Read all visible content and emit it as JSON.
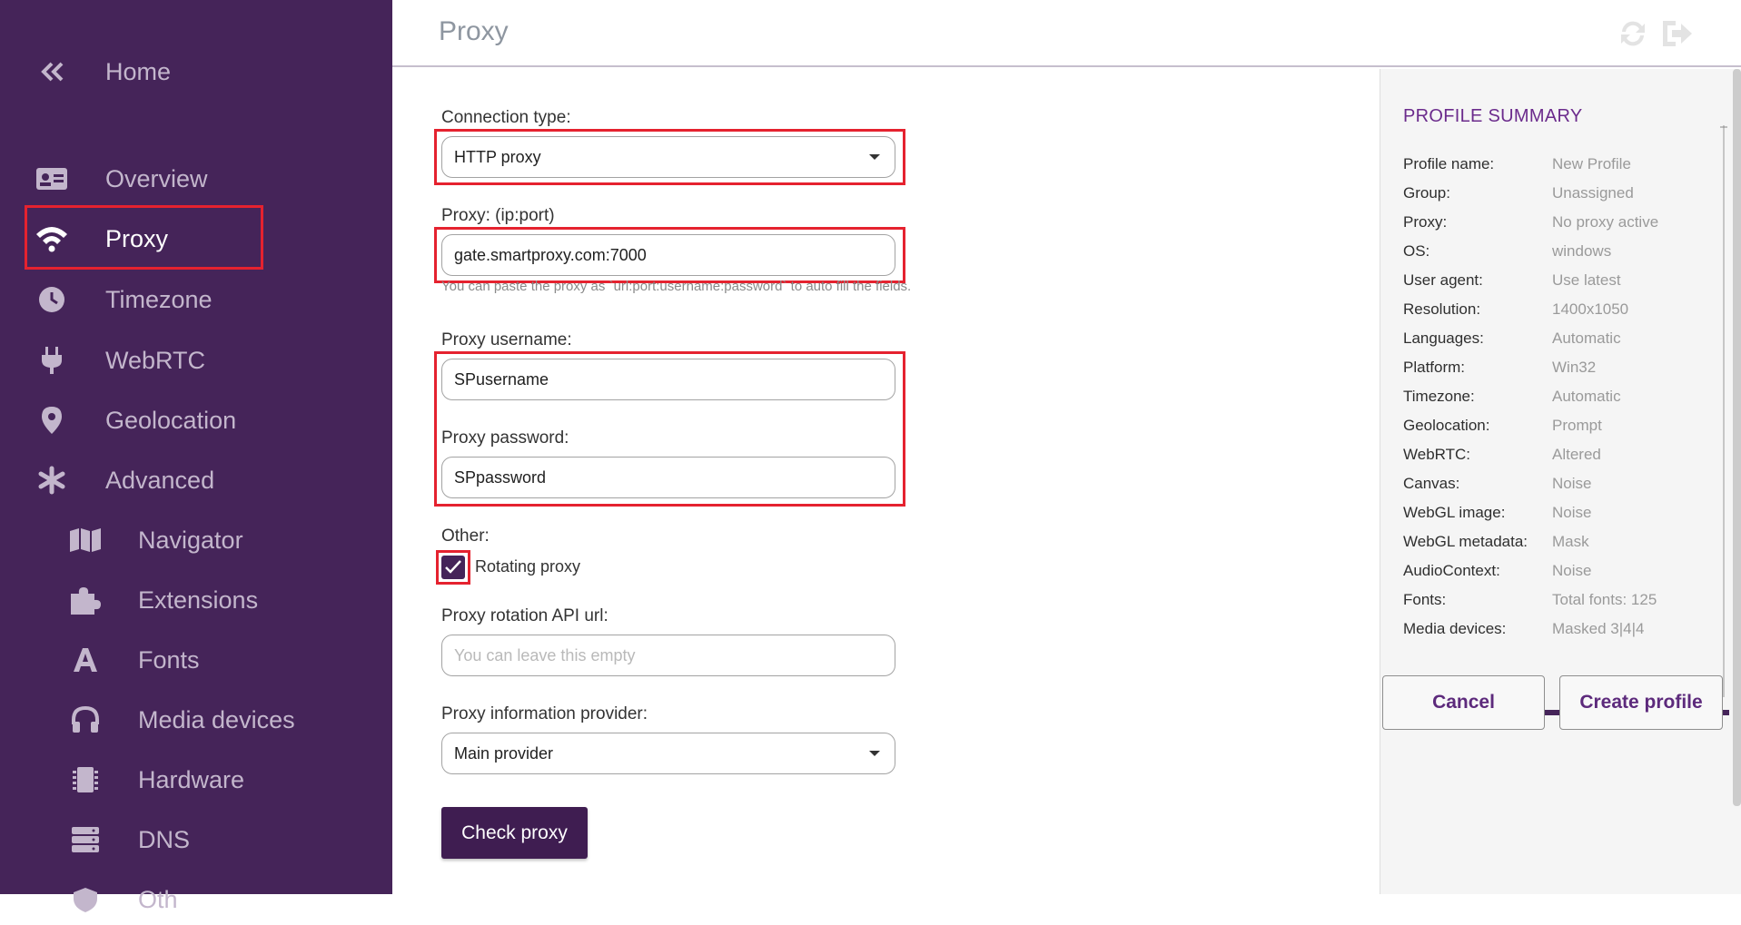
{
  "sidebar": {
    "home_label": "Home",
    "items": [
      {
        "label": "Overview",
        "icon": "id-card-icon"
      },
      {
        "label": "Proxy",
        "icon": "wifi-icon"
      },
      {
        "label": "Timezone",
        "icon": "clock-icon"
      },
      {
        "label": "WebRTC",
        "icon": "plug-icon"
      },
      {
        "label": "Geolocation",
        "icon": "map-pin-icon"
      },
      {
        "label": "Advanced",
        "icon": "asterisk-icon"
      }
    ],
    "sub_items": [
      {
        "label": "Navigator",
        "icon": "map-icon"
      },
      {
        "label": "Extensions",
        "icon": "puzzle-icon"
      },
      {
        "label": "Fonts",
        "icon": "font-icon"
      },
      {
        "label": "Media devices",
        "icon": "headphones-icon"
      },
      {
        "label": "Hardware",
        "icon": "chip-icon"
      },
      {
        "label": "DNS",
        "icon": "server-icon"
      },
      {
        "label": "Oth",
        "icon": "shield-icon"
      }
    ],
    "active": "Proxy"
  },
  "header": {
    "title": "Proxy",
    "refresh_icon": "refresh-icon",
    "logout_icon": "logout-icon"
  },
  "form": {
    "connection_type": {
      "label": "Connection type:",
      "value": "HTTP proxy"
    },
    "proxy_address": {
      "label": "Proxy: (ip:port)",
      "value": "gate.smartproxy.com:7000",
      "hint": "You can paste the proxy as `url:port:username:password` to auto fill the fields."
    },
    "username": {
      "label": "Proxy username:",
      "value": "SPusername"
    },
    "password": {
      "label": "Proxy password:",
      "value": "SPpassword"
    },
    "other": {
      "label": "Other:",
      "rotating_label": "Rotating proxy",
      "rotating_checked": true
    },
    "rotation_api": {
      "label": "Proxy rotation API url:",
      "placeholder": "You can leave this empty",
      "value": ""
    },
    "info_provider": {
      "label": "Proxy information provider:",
      "value": "Main provider"
    },
    "check_button": "Check proxy"
  },
  "summary": {
    "title": "PROFILE SUMMARY",
    "rows": [
      {
        "key": "Profile name:",
        "value": "New Profile"
      },
      {
        "key": "Group:",
        "value": "Unassigned"
      },
      {
        "key": "Proxy:",
        "value": "No proxy active"
      },
      {
        "key": "OS:",
        "value": "windows"
      },
      {
        "key": "User agent:",
        "value": "Use latest"
      },
      {
        "key": "Resolution:",
        "value": "1400x1050"
      },
      {
        "key": "Languages:",
        "value": "Automatic"
      },
      {
        "key": "Platform:",
        "value": "Win32"
      },
      {
        "key": "Timezone:",
        "value": "Automatic"
      },
      {
        "key": "Geolocation:",
        "value": "Prompt"
      },
      {
        "key": "WebRTC:",
        "value": "Altered"
      },
      {
        "key": "Canvas:",
        "value": "Noise"
      },
      {
        "key": "WebGL image:",
        "value": "Noise"
      },
      {
        "key": "WebGL metadata:",
        "value": "Mask"
      },
      {
        "key": "AudioContext:",
        "value": "Noise"
      },
      {
        "key": "Fonts:",
        "value": "Total fonts: 125"
      },
      {
        "key": "Media devices:",
        "value": "Masked 3|4|4"
      }
    ],
    "cancel_button": "Cancel",
    "create_button": "Create profile"
  },
  "colors": {
    "sidebar_bg": "#452459",
    "accent": "#6b2b8c",
    "highlight": "#e5222f"
  }
}
